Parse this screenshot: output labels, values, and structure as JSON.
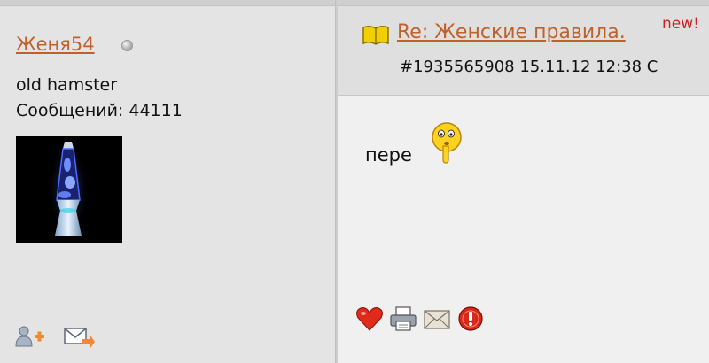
{
  "user": {
    "name": "Женя54",
    "status": "offline",
    "title": "old hamster",
    "post_count_text": "Сообщений: 44111",
    "avatar_description": "lava-lamp-avatar"
  },
  "post": {
    "subject": "Re: Женские правила.",
    "new_label": "new!",
    "meta": "#1935565908 15.11.12 12:38  C",
    "body_text": "пере"
  },
  "icons": {
    "subject": "book-icon",
    "smiley": "silence-smiley-icon",
    "user_actions": [
      "add-friend-icon",
      "send-message-icon"
    ],
    "post_actions": [
      "heart-icon",
      "print-icon",
      "email-icon",
      "report-icon"
    ]
  },
  "colors": {
    "link": "#c0612b",
    "new_badge": "#d42020",
    "left_bg": "#e4e4e4",
    "header_bg": "#dfdfdf",
    "body_bg": "#f0f0f0"
  }
}
